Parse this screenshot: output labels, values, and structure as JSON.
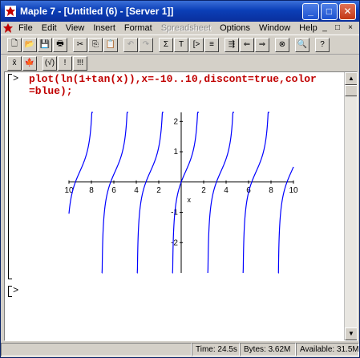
{
  "window": {
    "title": "Maple 7 - [Untitled (6) - [Server 1]]"
  },
  "titlebar_buttons": {
    "minimize": "_",
    "maximize": "□",
    "close": "✕"
  },
  "menu": [
    "File",
    "Edit",
    "View",
    "Insert",
    "Format",
    "Spreadsheet",
    "Options",
    "Window",
    "Help"
  ],
  "menu_disabled": [
    "Spreadsheet"
  ],
  "doc_controls": [
    "_",
    "□",
    "×"
  ],
  "toolbar1": [
    {
      "name": "new-icon",
      "glyph": "🗋"
    },
    {
      "name": "open-icon",
      "glyph": "📂"
    },
    {
      "name": "save-icon",
      "glyph": "💾"
    },
    {
      "name": "print-icon",
      "glyph": "🖶"
    },
    {
      "name": "cut-icon",
      "glyph": "✂"
    },
    {
      "name": "copy-icon",
      "glyph": "⎘"
    },
    {
      "name": "paste-icon",
      "glyph": "📋"
    },
    {
      "name": "undo-icon",
      "glyph": "↶",
      "disabled": true
    },
    {
      "name": "redo-icon",
      "glyph": "↷",
      "disabled": true
    },
    {
      "name": "sigma-icon",
      "glyph": "Σ"
    },
    {
      "name": "text-icon",
      "glyph": "T"
    },
    {
      "name": "prompt-icon",
      "glyph": "[>"
    },
    {
      "name": "section-icon",
      "glyph": "≡"
    },
    {
      "name": "subsection-icon",
      "glyph": "⇶"
    },
    {
      "name": "indent-left-icon",
      "glyph": "⇐"
    },
    {
      "name": "indent-right-icon",
      "glyph": "⇒"
    },
    {
      "name": "stop-icon",
      "glyph": "⊗"
    },
    {
      "name": "zoom-icon",
      "glyph": "🔍"
    },
    {
      "name": "help-icon",
      "glyph": "?"
    }
  ],
  "toolbar2": [
    {
      "name": "palette-icon",
      "glyph": "x̄"
    },
    {
      "name": "maple-leaf-icon",
      "glyph": "🍁"
    },
    {
      "name": "math-input-icon",
      "glyph": "(√)"
    },
    {
      "name": "execute-icon",
      "glyph": "!"
    },
    {
      "name": "execute-all-icon",
      "glyph": "!!!"
    }
  ],
  "document": {
    "prompt": ">",
    "command_line1": "plot(ln(1+tan(x)),x=-10..10,discont=true,color",
    "command_line2": "=blue);",
    "empty_prompt": ">"
  },
  "chart_data": {
    "type": "line",
    "title": "",
    "xlabel": "x",
    "ylabel": "",
    "xlim": [
      -10,
      10
    ],
    "ylim": [
      -3,
      2.3
    ],
    "x_tick_labels": [
      "10",
      "8",
      "6",
      "4",
      "2",
      "2",
      "4",
      "6",
      "8",
      "10"
    ],
    "x_ticks": [
      -10,
      -8,
      -6,
      -4,
      -2,
      2,
      4,
      6,
      8,
      10
    ],
    "y_tick_labels": [
      "2",
      "1",
      "-1",
      "-2"
    ],
    "y_ticks": [
      2,
      1,
      -1,
      -2
    ],
    "series": [
      {
        "expression": "ln(1+tan(x))",
        "color": "#0000ff",
        "discont": true
      }
    ]
  },
  "status": {
    "time": "Time: 24.5s",
    "bytes": "Bytes: 3.62M",
    "available": "Available: 31.5M"
  }
}
